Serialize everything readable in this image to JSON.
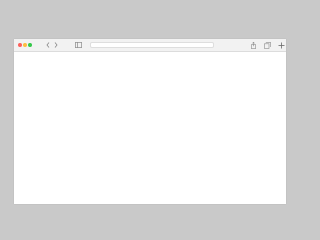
{
  "window": {
    "address": {
      "url_text": "",
      "placeholder": ""
    },
    "icons": {
      "close": "close-traffic-light",
      "minimize": "minimize-traffic-light",
      "maximize": "maximize-traffic-light",
      "back": "chevron-left-icon",
      "forward": "chevron-right-icon",
      "sidebar": "sidebar-icon",
      "lock": "lock-icon",
      "reload": "reload-icon",
      "share": "share-icon",
      "tabs": "tabs-overview-icon",
      "new_tab": "plus-icon"
    },
    "colors": {
      "desktop_bg": "#c9c9c9",
      "toolbar_bg": "#f2f2f2",
      "content_bg": "#ffffff",
      "close": "#fc605b",
      "minimize": "#fdbc40",
      "maximize": "#34c84a"
    }
  }
}
